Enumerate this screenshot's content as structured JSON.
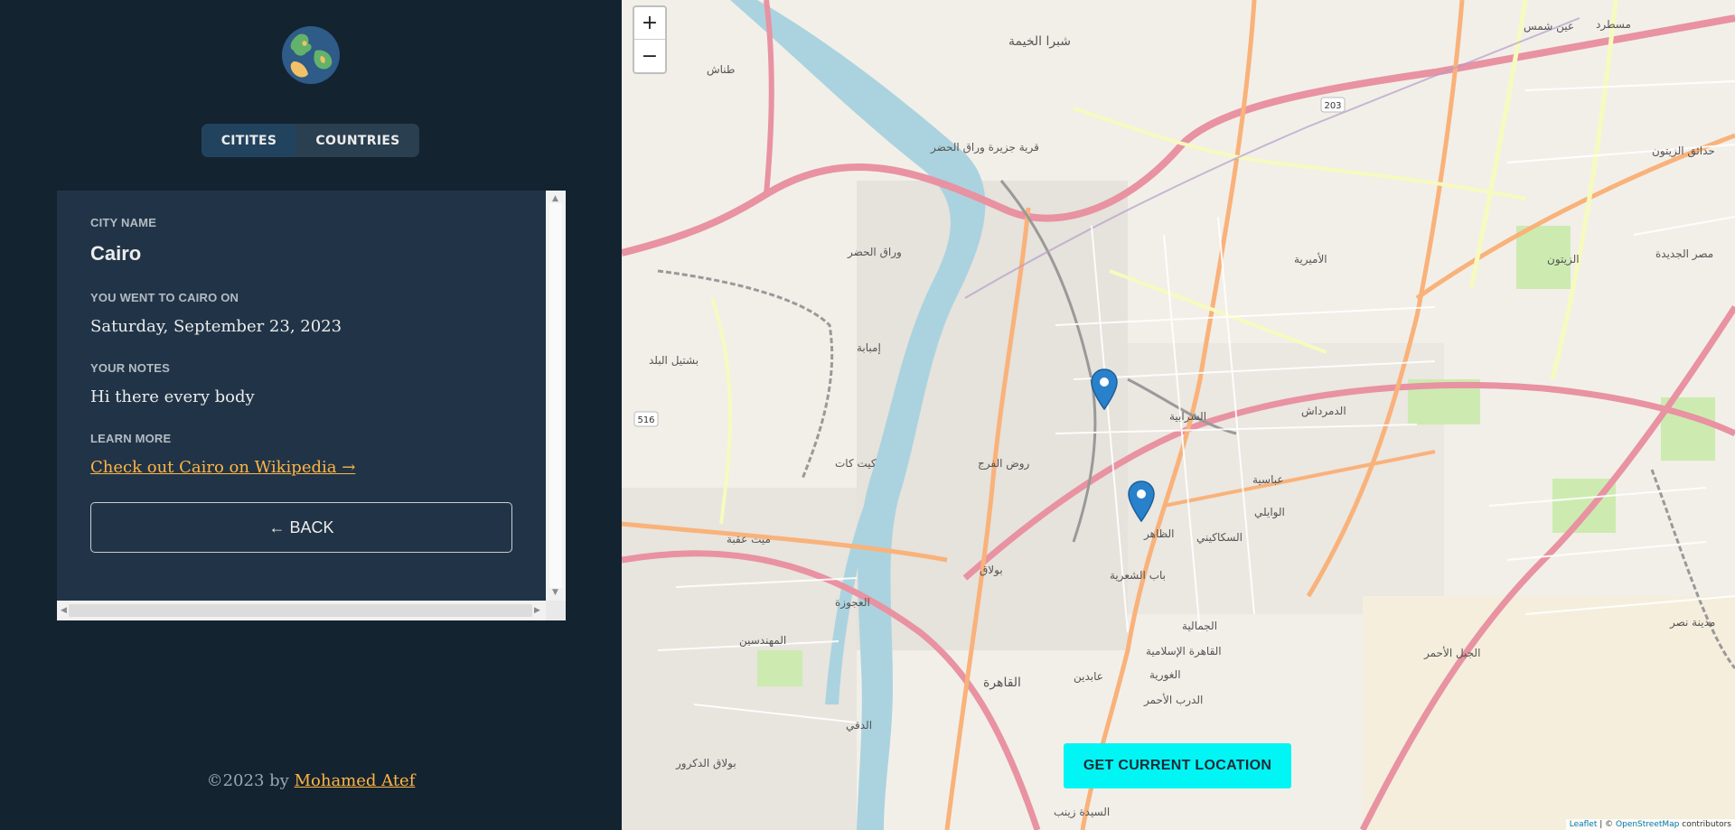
{
  "sidebar": {
    "tabs": [
      {
        "label": "CITITES",
        "active": true
      },
      {
        "label": "COUNTRIES",
        "active": false
      }
    ],
    "details": {
      "city_label": "CITY NAME",
      "city_name": "Cairo",
      "date_label": "YOU WENT TO CAIRO ON",
      "date_value": "Saturday, September 23, 2023",
      "notes_label": "YOUR NOTES",
      "notes_value": "Hi there every body",
      "learn_label": "LEARN MORE",
      "wiki_link": "Check out Cairo on Wikipedia →",
      "back_button": "← BACK"
    },
    "footer": {
      "prefix": "©2023 by",
      "author": "Mohamed Atef"
    }
  },
  "map": {
    "zoom_in": "+",
    "zoom_out": "−",
    "geolocation_button": "GET CURRENT LOCATION",
    "attribution": {
      "leaflet": "Leaflet",
      "separator": " | © ",
      "osm": "OpenStreetMap",
      "suffix": " contributors"
    },
    "labels": [
      "شبرا الخيمة",
      "عين شمس",
      "الأميرية",
      "حدائق الزيتون",
      "الزيتون",
      "مصر الجديدة",
      "وراق الحضر",
      "إمبابة",
      "بشتيل البلد",
      "كيت كات",
      "روض الفرج",
      "الشرابية",
      "الدمرداش",
      "عباسية",
      "الوايلي",
      "الظاهر",
      "السكاكيني",
      "بولاق",
      "ميت عقبة",
      "العجوزة",
      "المهندسين",
      "باب الشعرية",
      "الجمالية",
      "القاهرة",
      "عابدين",
      "الدرب الأحمر",
      "الغورية",
      "القاهرة الإسلامية",
      "بولاق الدكرور",
      "الدقي",
      "السيدة زينب",
      "الجبل الأحمر",
      "مدينة نصر",
      "مسطرد",
      "طناش",
      "قرية جزيرة وراق الحضر"
    ],
    "colors": {
      "water": "#aad3df",
      "motorway": "#e892a2",
      "primary": "#fcd6a4",
      "secondary": "#f7fabf",
      "marker": "#2a81cb",
      "button": "#00f5f5"
    }
  },
  "colors": {
    "sidebar_bg": "#142330",
    "panel_bg": "#213447",
    "accent": "#ffb545",
    "tab_active": "#22435e"
  }
}
